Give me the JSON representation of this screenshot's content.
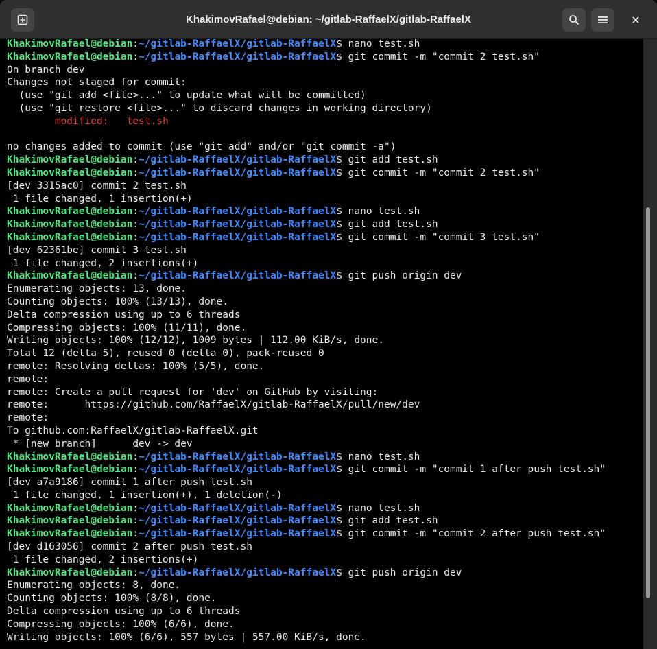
{
  "window": {
    "title": "KhakimovRafael@debian: ~/gitlab-RaffaelX/gitlab-RaffaelX"
  },
  "icons": {
    "new_tab": "new-tab-icon",
    "search": "search-icon",
    "menu": "hamburger-menu-icon",
    "close": "close-icon"
  },
  "colors": {
    "user_host": "#4fe67f",
    "path": "#3d8bff",
    "modified": "#e63b3b",
    "background": "#000000"
  },
  "terminal": {
    "lines": [
      {
        "type": "prompt",
        "user": "KhakimovRafael@debian",
        "sep": ":",
        "path": "~/gitlab-RaffaelX/gitlab-RaffaelX",
        "sym": "$ ",
        "cmd": "nano test.sh"
      },
      {
        "type": "prompt",
        "user": "KhakimovRafael@debian",
        "sep": ":",
        "path": "~/gitlab-RaffaelX/gitlab-RaffaelX",
        "sym": "$ ",
        "cmd": "git commit -m \"commit 2 test.sh\""
      },
      {
        "type": "out",
        "text": "On branch dev"
      },
      {
        "type": "out",
        "text": "Changes not staged for commit:"
      },
      {
        "type": "out",
        "text": "  (use \"git add <file>...\" to update what will be committed)"
      },
      {
        "type": "out",
        "text": "  (use \"git restore <file>...\" to discard changes in working directory)"
      },
      {
        "type": "red",
        "text": "        modified:   test.sh"
      },
      {
        "type": "out",
        "text": ""
      },
      {
        "type": "out",
        "text": "no changes added to commit (use \"git add\" and/or \"git commit -a\")"
      },
      {
        "type": "prompt",
        "user": "KhakimovRafael@debian",
        "sep": ":",
        "path": "~/gitlab-RaffaelX/gitlab-RaffaelX",
        "sym": "$ ",
        "cmd": "git add test.sh"
      },
      {
        "type": "prompt",
        "user": "KhakimovRafael@debian",
        "sep": ":",
        "path": "~/gitlab-RaffaelX/gitlab-RaffaelX",
        "sym": "$ ",
        "cmd": "git commit -m \"commit 2 test.sh\""
      },
      {
        "type": "out",
        "text": "[dev 3315ac0] commit 2 test.sh"
      },
      {
        "type": "out",
        "text": " 1 file changed, 1 insertion(+)"
      },
      {
        "type": "prompt",
        "user": "KhakimovRafael@debian",
        "sep": ":",
        "path": "~/gitlab-RaffaelX/gitlab-RaffaelX",
        "sym": "$ ",
        "cmd": "nano test.sh"
      },
      {
        "type": "prompt",
        "user": "KhakimovRafael@debian",
        "sep": ":",
        "path": "~/gitlab-RaffaelX/gitlab-RaffaelX",
        "sym": "$ ",
        "cmd": "git add test.sh"
      },
      {
        "type": "prompt",
        "user": "KhakimovRafael@debian",
        "sep": ":",
        "path": "~/gitlab-RaffaelX/gitlab-RaffaelX",
        "sym": "$ ",
        "cmd": "git commit -m \"commit 3 test.sh\""
      },
      {
        "type": "out",
        "text": "[dev 62361be] commit 3 test.sh"
      },
      {
        "type": "out",
        "text": " 1 file changed, 2 insertions(+)"
      },
      {
        "type": "prompt",
        "user": "KhakimovRafael@debian",
        "sep": ":",
        "path": "~/gitlab-RaffaelX/gitlab-RaffaelX",
        "sym": "$ ",
        "cmd": "git push origin dev"
      },
      {
        "type": "out",
        "text": "Enumerating objects: 13, done."
      },
      {
        "type": "out",
        "text": "Counting objects: 100% (13/13), done."
      },
      {
        "type": "out",
        "text": "Delta compression using up to 6 threads"
      },
      {
        "type": "out",
        "text": "Compressing objects: 100% (11/11), done."
      },
      {
        "type": "out",
        "text": "Writing objects: 100% (12/12), 1009 bytes | 112.00 KiB/s, done."
      },
      {
        "type": "out",
        "text": "Total 12 (delta 5), reused 0 (delta 0), pack-reused 0"
      },
      {
        "type": "out",
        "text": "remote: Resolving deltas: 100% (5/5), done."
      },
      {
        "type": "out",
        "text": "remote:"
      },
      {
        "type": "out",
        "text": "remote: Create a pull request for 'dev' on GitHub by visiting:"
      },
      {
        "type": "out",
        "text": "remote:      https://github.com/RaffaelX/gitlab-RaffaelX/pull/new/dev"
      },
      {
        "type": "out",
        "text": "remote:"
      },
      {
        "type": "out",
        "text": "To github.com:RaffaelX/gitlab-RaffaelX.git"
      },
      {
        "type": "out",
        "text": " * [new branch]      dev -> dev"
      },
      {
        "type": "prompt",
        "user": "KhakimovRafael@debian",
        "sep": ":",
        "path": "~/gitlab-RaffaelX/gitlab-RaffaelX",
        "sym": "$ ",
        "cmd": "nano test.sh"
      },
      {
        "type": "prompt",
        "user": "KhakimovRafael@debian",
        "sep": ":",
        "path": "~/gitlab-RaffaelX/gitlab-RaffaelX",
        "sym": "$ ",
        "cmd": "git commit -m \"commit 1 after push test.sh\""
      },
      {
        "type": "out",
        "text": "[dev a7a9186] commit 1 after push test.sh"
      },
      {
        "type": "out",
        "text": " 1 file changed, 1 insertion(+), 1 deletion(-)"
      },
      {
        "type": "prompt",
        "user": "KhakimovRafael@debian",
        "sep": ":",
        "path": "~/gitlab-RaffaelX/gitlab-RaffaelX",
        "sym": "$ ",
        "cmd": "nano test.sh"
      },
      {
        "type": "prompt",
        "user": "KhakimovRafael@debian",
        "sep": ":",
        "path": "~/gitlab-RaffaelX/gitlab-RaffaelX",
        "sym": "$ ",
        "cmd": "git add test.sh"
      },
      {
        "type": "prompt",
        "user": "KhakimovRafael@debian",
        "sep": ":",
        "path": "~/gitlab-RaffaelX/gitlab-RaffaelX",
        "sym": "$ ",
        "cmd": "git commit -m \"commit 2 after push test.sh\""
      },
      {
        "type": "out",
        "text": "[dev d163056] commit 2 after push test.sh"
      },
      {
        "type": "out",
        "text": " 1 file changed, 2 insertions(+)"
      },
      {
        "type": "prompt",
        "user": "KhakimovRafael@debian",
        "sep": ":",
        "path": "~/gitlab-RaffaelX/gitlab-RaffaelX",
        "sym": "$ ",
        "cmd": "git push origin dev"
      },
      {
        "type": "out",
        "text": "Enumerating objects: 8, done."
      },
      {
        "type": "out",
        "text": "Counting objects: 100% (8/8), done."
      },
      {
        "type": "out",
        "text": "Delta compression using up to 6 threads"
      },
      {
        "type": "out",
        "text": "Compressing objects: 100% (6/6), done."
      },
      {
        "type": "out",
        "text": "Writing objects: 100% (6/6), 557 bytes | 557.00 KiB/s, done."
      }
    ]
  }
}
